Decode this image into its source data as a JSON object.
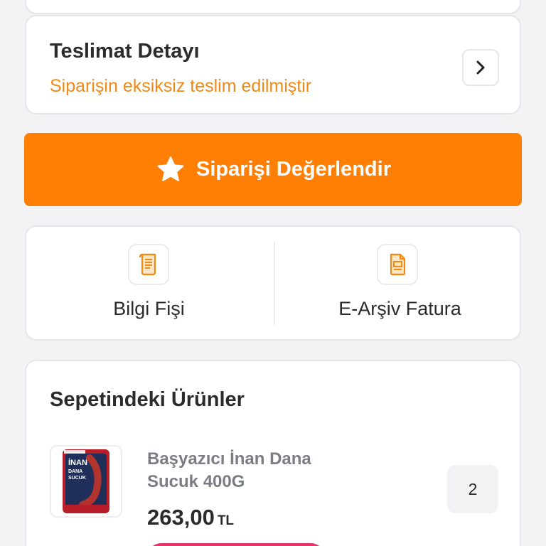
{
  "delivery": {
    "title": "Teslimat Detayı",
    "status": "Siparişin eksiksiz teslim edilmiştir",
    "chevron_icon": "chevron-right-icon"
  },
  "rate_button": {
    "label": "Siparişi Değerlendir",
    "icon": "star-icon"
  },
  "documents": [
    {
      "label": "Bilgi Fişi",
      "icon": "receipt-icon"
    },
    {
      "label": "E-Arşiv Fatura",
      "icon": "invoice-icon"
    }
  ],
  "basket": {
    "title": "Sepetindeki Ürünler",
    "items": [
      {
        "name": "Başyazıcı İnan Dana Sucuk 400G",
        "price": "263,00",
        "currency": "TL",
        "quantity": "2"
      }
    ]
  },
  "colors": {
    "accent": "#ff7f05",
    "status_text": "#f0891a",
    "pink": "#e6336a"
  }
}
